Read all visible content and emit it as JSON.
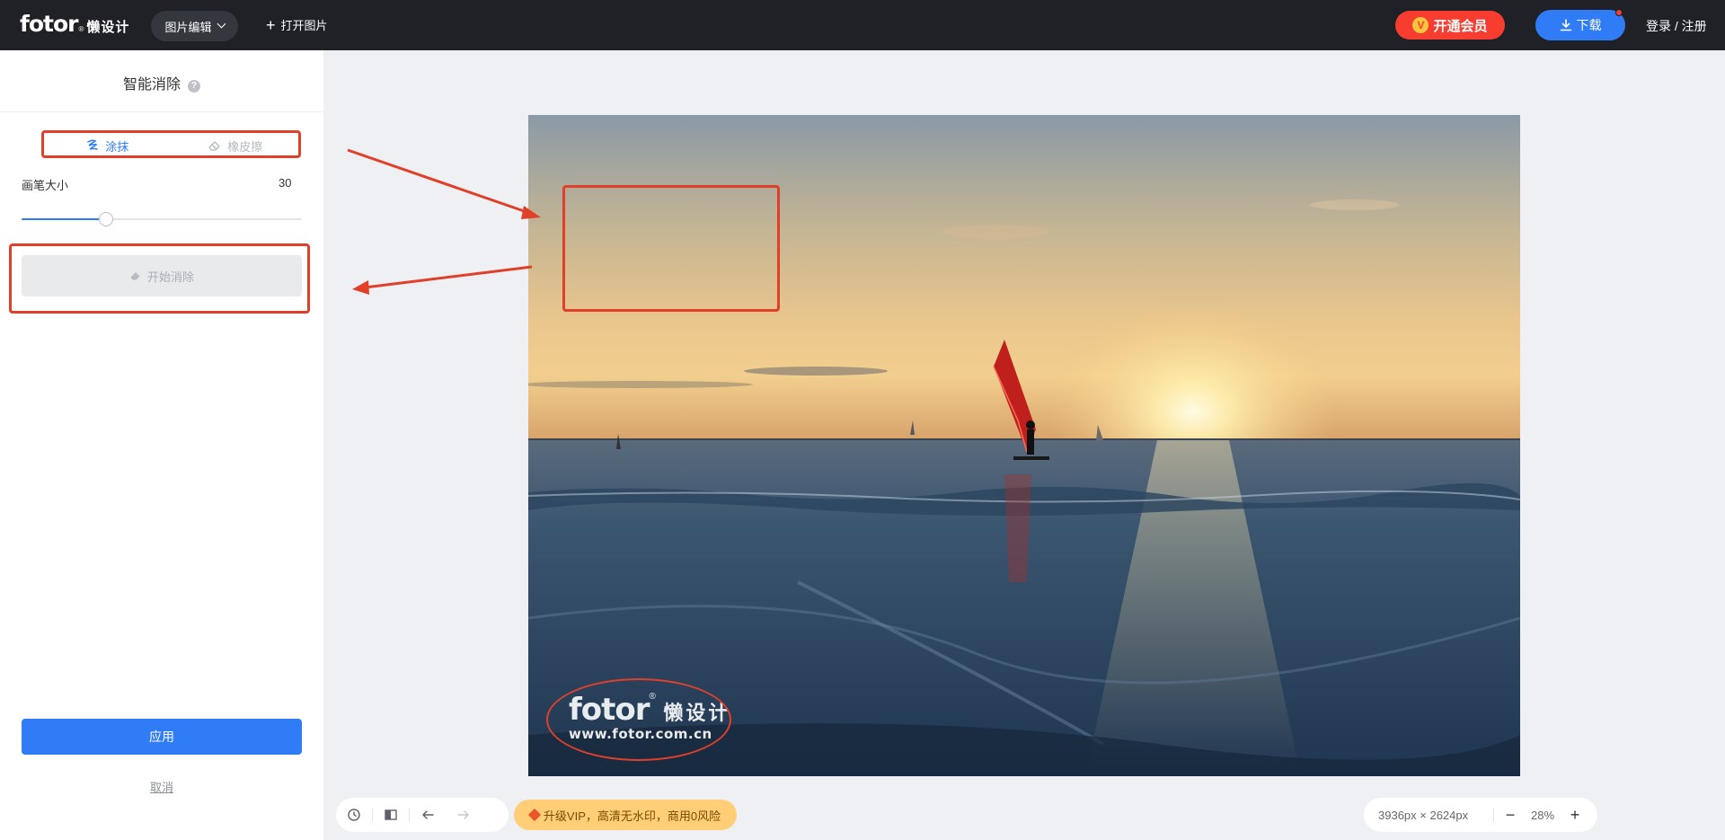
{
  "header": {
    "brand": "fotor",
    "brand_reg": "®",
    "brand_cn": "懒设计",
    "menu_label": "图片编辑",
    "open_label": "打开图片",
    "vip_label": "开通会员",
    "vip_icon_text": "V",
    "download_label": "下载",
    "login_label": "登录 / 注册"
  },
  "panel": {
    "title": "智能消除",
    "help_text": "?",
    "tabs": [
      {
        "label": "涂抹",
        "icon": "brush-icon",
        "active": true
      },
      {
        "label": "橡皮擦",
        "icon": "eraser-icon",
        "active": false
      }
    ],
    "brush_label": "画笔大小",
    "brush_value": "30",
    "brush_value_num": 30,
    "brush_max": 100,
    "start_label": "开始消除",
    "apply_label": "应用",
    "cancel_label": "取消"
  },
  "watermark": {
    "brand": "fotor",
    "reg": "®",
    "cn": "懒设计",
    "url": "www.fotor.com.cn"
  },
  "bottom": {
    "vip_note": "升级VIP，高清无水印，商用0风险",
    "dimensions": "3936px × 2624px",
    "zoom": "28%",
    "zoom_out": "−",
    "zoom_in": "+"
  },
  "colors": {
    "accent": "#2f7cf6",
    "vip_red": "#f73d2f",
    "annotation": "#e0402a",
    "topbar": "#1f2127"
  }
}
